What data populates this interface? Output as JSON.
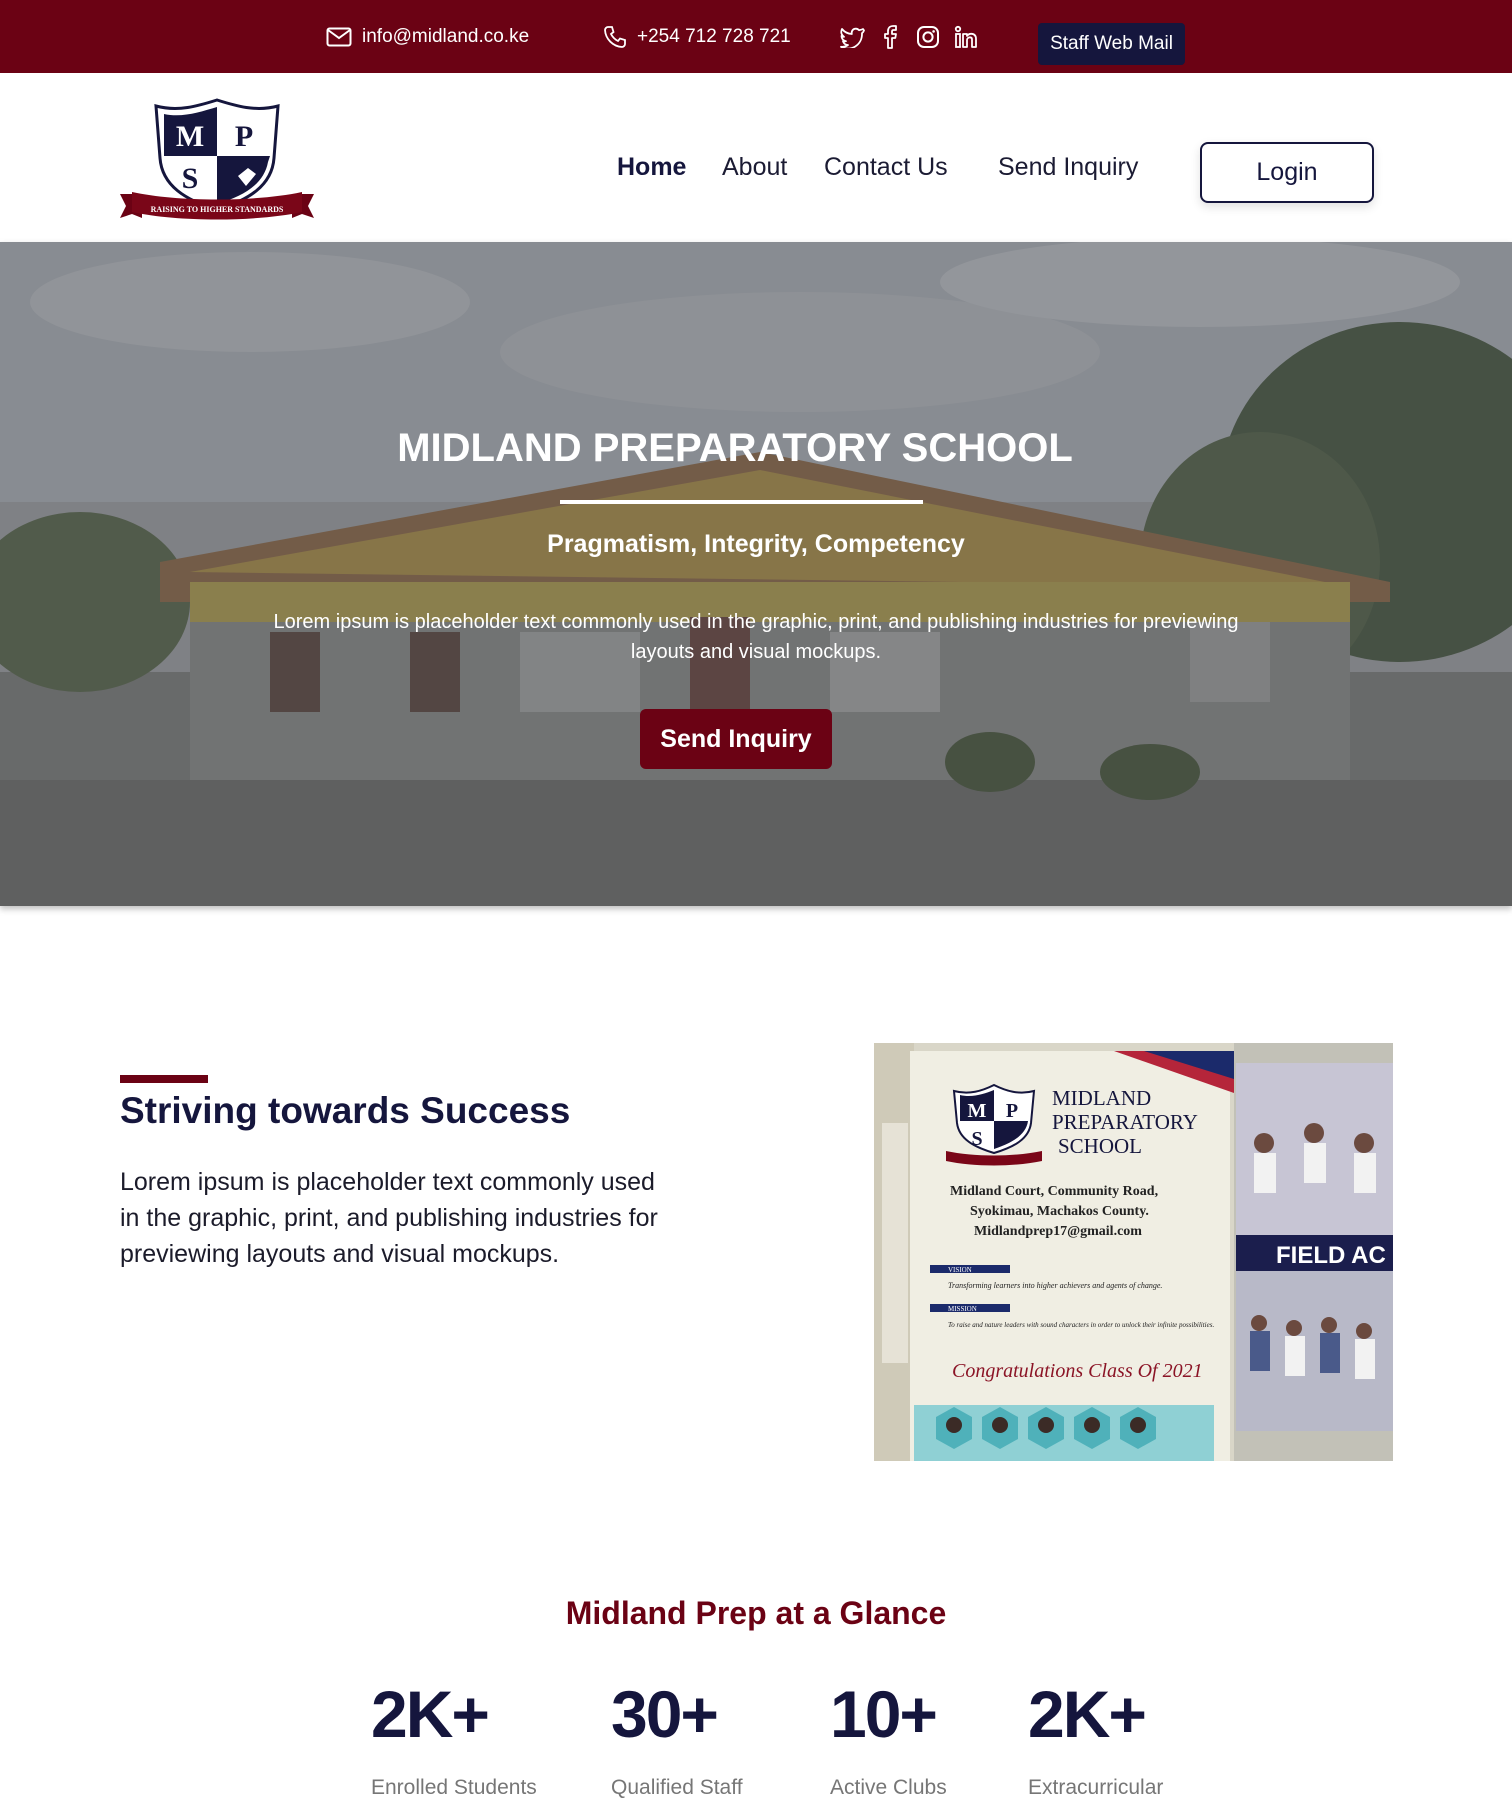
{
  "topbar": {
    "email": "info@midland.co.ke",
    "phone": "+254 712 728 721",
    "social_icons": [
      "twitter-icon",
      "facebook-icon",
      "instagram-icon",
      "linkedin-icon"
    ],
    "webmail_label": "Staff Web Mail"
  },
  "logo": {
    "letters": [
      "M",
      "P",
      "S"
    ],
    "motto_ribbon": "RAISING TO HIGHER STANDARDS"
  },
  "nav": {
    "items": [
      "Home",
      "About",
      "Contact Us",
      "Send Inquiry"
    ],
    "active": "Home",
    "login_label": "Login"
  },
  "hero": {
    "title": "MIDLAND PREPARATORY SCHOOL",
    "motto": "Pragmatism, Integrity, Competency",
    "description": "Lorem ipsum is placeholder text commonly used in the graphic, print, and publishing industries for previewing layouts and visual mockups.",
    "button_label": "Send Inquiry"
  },
  "about": {
    "title": "Striving towards Success",
    "text": "Lorem ipsum is placeholder text commonly used in the graphic, print, and publishing industries for previewing layouts and visual mockups.",
    "photo": {
      "school_name_lines": [
        "MIDLAND",
        "PREPARATORY",
        "SCHOOL"
      ],
      "address_lines": [
        "Midland Court, Community Road,",
        "Syokimau, Machakos County.",
        "Midlandprep17@gmail.com"
      ],
      "vision_label": "VISION",
      "vision_text": "Transforming learners into higher achievers and agents of change.",
      "mission_label": "MISSION",
      "mission_text": "To raise and nature leaders with sound characters in order to unlock their infinite possibilities.",
      "congrats": "Congratulations Class Of 2021",
      "field_label": "FIELD AC"
    }
  },
  "glance": {
    "title": "Midland Prep at a Glance",
    "stats": [
      {
        "value": "2K+",
        "label": "Enrolled Students"
      },
      {
        "value": "30+",
        "label": "Qualified Staff"
      },
      {
        "value": "10+",
        "label": "Active Clubs"
      },
      {
        "value": "2K+",
        "label": "Extracurricular"
      }
    ]
  },
  "colors": {
    "maroon": "#6b0214",
    "navy": "#15163d",
    "muted_text": "#767676"
  }
}
